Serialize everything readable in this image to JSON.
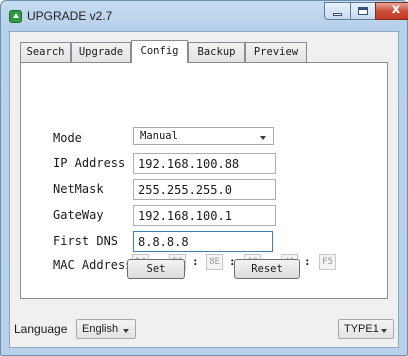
{
  "window": {
    "title": "UPGRADE v2.7",
    "close_glyph": "x",
    "icons": [
      "app-icon",
      "minimize-icon",
      "maximize-icon",
      "close-icon"
    ]
  },
  "tabs": [
    {
      "label": "Search",
      "active": false
    },
    {
      "label": "Upgrade",
      "active": false
    },
    {
      "label": "Config",
      "active": true
    },
    {
      "label": "Backup",
      "active": false
    },
    {
      "label": "Preview",
      "active": false
    }
  ],
  "config": {
    "mode": {
      "label": "Mode",
      "value": "Manual"
    },
    "ip": {
      "label": "IP Address",
      "value": "192.168.100.88"
    },
    "netmask": {
      "label": "NetMask",
      "value": "255.255.255.0"
    },
    "gateway": {
      "label": "GateWay",
      "value": "192.168.100.1"
    },
    "dns": {
      "label": "First DNS",
      "value": "8.8.8.8"
    },
    "mac": {
      "label": "MAC Address",
      "octets": [
        "D4",
        "E0",
        "8E",
        "A0",
        "41",
        "F5"
      ],
      "separator": ":"
    },
    "set_label": "Set",
    "reset_label": "Reset"
  },
  "footer": {
    "language_label": "Language",
    "language_value": "English",
    "type_value": "TYPE1"
  }
}
